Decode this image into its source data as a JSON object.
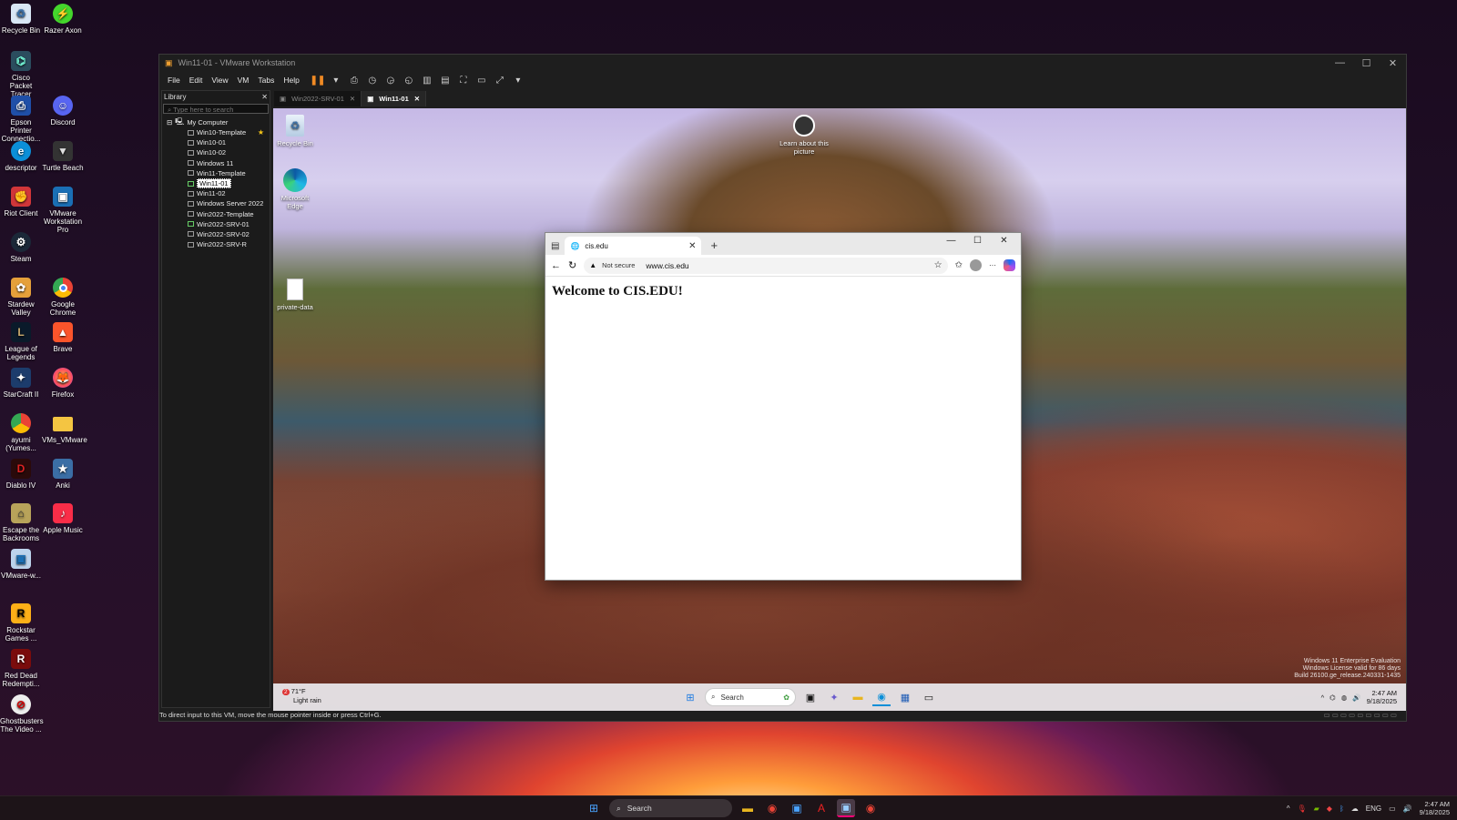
{
  "host_desktop": {
    "icons": [
      {
        "label": "Recycle Bin",
        "icon": "recycle-bin-icon"
      },
      {
        "label": "Razer Axon",
        "icon": "razer-axon-icon"
      },
      {
        "label": "Cisco Packet Tracer",
        "icon": "cisco-packet-tracer-icon"
      },
      {
        "label": "Epson Printer Connectio...",
        "icon": "epson-printer-icon"
      },
      {
        "label": "Discord",
        "icon": "discord-icon"
      },
      {
        "label": "descriptor",
        "icon": "edge-icon"
      },
      {
        "label": "Turtle Beach",
        "icon": "turtle-beach-icon"
      },
      {
        "label": "Riot Client",
        "icon": "riot-client-icon"
      },
      {
        "label": "VMware Workstation Pro",
        "icon": "vmware-icon"
      },
      {
        "label": "Steam",
        "icon": "steam-icon"
      },
      {
        "label": "Stardew Valley",
        "icon": "stardew-valley-icon"
      },
      {
        "label": "Google Chrome",
        "icon": "chrome-icon"
      },
      {
        "label": "League of Legends",
        "icon": "league-of-legends-icon"
      },
      {
        "label": "Brave",
        "icon": "brave-icon"
      },
      {
        "label": "StarCraft II",
        "icon": "starcraft-icon"
      },
      {
        "label": "Firefox",
        "icon": "firefox-icon"
      },
      {
        "label": "ayumi (Yumes...",
        "icon": "chrome-profile-icon"
      },
      {
        "label": "VMs_VMware",
        "icon": "folder-icon"
      },
      {
        "label": "Diablo IV",
        "icon": "diablo-icon"
      },
      {
        "label": "Anki",
        "icon": "anki-icon"
      },
      {
        "label": "Escape the Backrooms",
        "icon": "escape-backrooms-icon"
      },
      {
        "label": "Apple Music",
        "icon": "apple-music-icon"
      },
      {
        "label": "VMware-w...",
        "icon": "vmware-installer-icon"
      },
      {
        "label": "Rockstar Games ...",
        "icon": "rockstar-icon"
      },
      {
        "label": "Red Dead Redempti...",
        "icon": "red-dead-icon"
      },
      {
        "label": "Ghostbusters The Video ...",
        "icon": "ghostbusters-icon"
      }
    ]
  },
  "vmware": {
    "title": "Win11-01 - VMware Workstation",
    "menu": [
      "File",
      "Edit",
      "View",
      "VM",
      "Tabs",
      "Help"
    ],
    "library": {
      "header": "Library",
      "search_placeholder": "Type here to search",
      "root": "My Computer",
      "vms": [
        "Win10-Template",
        "Win10-01",
        "Win10-02",
        "Windows 11",
        "Win11-Template",
        "Win11-01",
        "Win11-02",
        "Windows Server 2022",
        "Win2022-Template",
        "Win2022-SRV-01",
        "Win2022-SRV-02",
        "Win2022-SRV-R"
      ]
    },
    "tabs": [
      "Win2022-SRV-01",
      "Win11-01"
    ],
    "status": "To direct input to this VM, move the mouse pointer inside or press Ctrl+G."
  },
  "guest": {
    "icons": [
      {
        "label": "Recycle Bin"
      },
      {
        "label": "Microsoft Edge"
      },
      {
        "label": "private-data"
      },
      {
        "label": "Learn about this picture"
      }
    ],
    "browser": {
      "tab_title": "cis.edu",
      "not_secure": "Not secure",
      "url": "www.cis.edu",
      "heading": "Welcome to CIS.EDU!"
    },
    "taskbar": {
      "temp": "71°F",
      "weather": "Light rain",
      "badge": "2",
      "search": "Search",
      "time": "2:47 AM",
      "date": "9/18/2025"
    },
    "watermark": {
      "line1": "Windows 11 Enterprise Evaluation",
      "line2": "Windows License valid for 86 days",
      "line3": "Build 26100.ge_release.240331-1435"
    }
  },
  "host_taskbar": {
    "search": "Search",
    "lang": "ENG",
    "time": "2:47 AM",
    "date": "9/18/2025"
  }
}
